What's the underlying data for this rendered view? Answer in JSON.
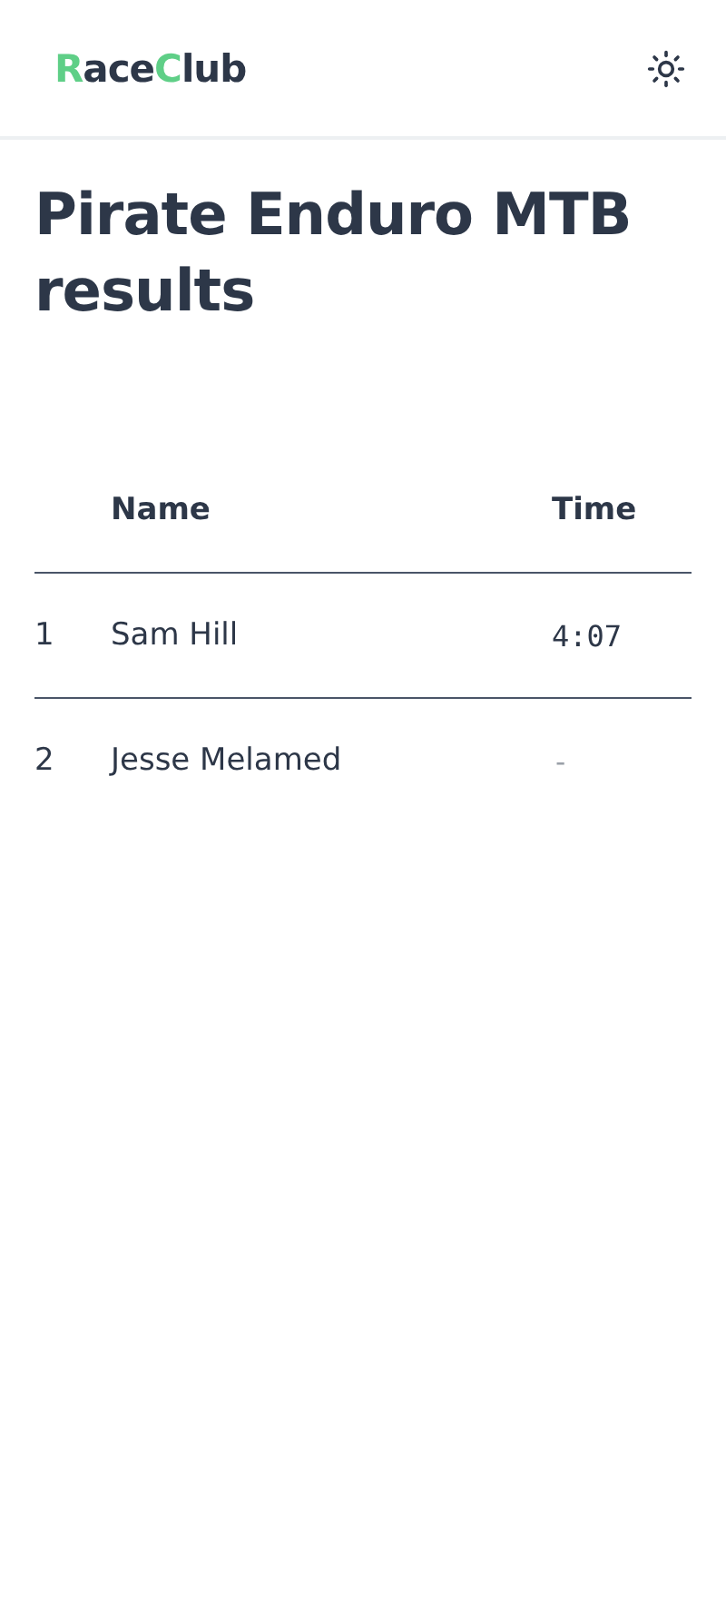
{
  "header": {
    "logo": [
      {
        "text": "R",
        "accent": true
      },
      {
        "text": "ace",
        "accent": false
      },
      {
        "text": "C",
        "accent": true
      },
      {
        "text": "lub",
        "accent": false
      }
    ]
  },
  "title": "Pirate Enduro MTB results",
  "table": {
    "columns": [
      {
        "label": "Name"
      },
      {
        "label": "Time"
      }
    ],
    "rows": [
      {
        "rank": "1",
        "name": "Sam Hill",
        "time": "4:07",
        "finished": true
      },
      {
        "rank": "2",
        "name": "Jesse Melamed",
        "time": "-",
        "finished": false
      }
    ]
  }
}
